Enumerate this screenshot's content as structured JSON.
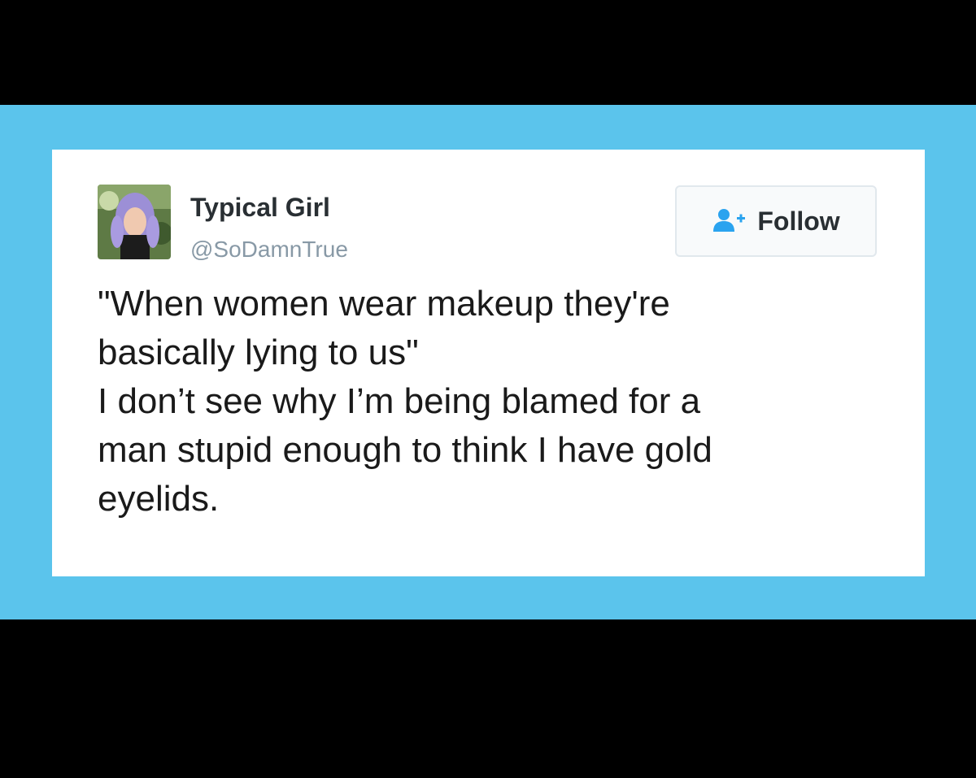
{
  "tweet": {
    "author_name": "Typical Girl",
    "author_handle": "@SoDamnTrue",
    "avatar_icon": "profile-photo",
    "follow_label": "Follow",
    "follow_icon": "add-user-icon",
    "text_lines": [
      "\"When women wear makeup they're",
      "basically lying to us\"",
      "I don’t see why I’m being blamed for a",
      "man stupid enough to think I have gold",
      "eyelids."
    ]
  },
  "colors": {
    "background": "#000000",
    "band": "#5bc4ec",
    "card": "#ffffff",
    "follow_icon": "#2aa3ef"
  }
}
